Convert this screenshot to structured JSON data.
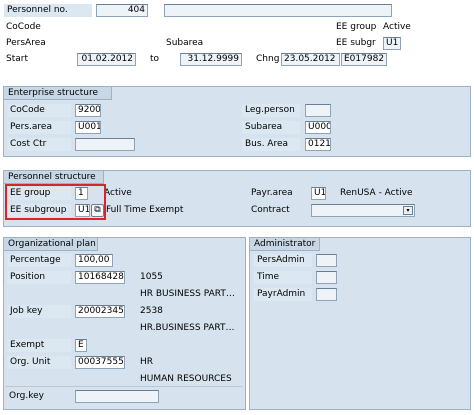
{
  "header": {
    "personnel_no_label": "Personnel no.",
    "personnel_no_value": "404",
    "personnel_name_value": "",
    "cocode_label": "CoCode",
    "ee_group_label": "EE group",
    "ee_group_value": "Active",
    "persarea_label": "PersArea",
    "subarea_label": "Subarea",
    "ee_subgr_label": "EE subgr",
    "ee_subgr_value": "U1",
    "start_label": "Start",
    "start_value": "01.02.2012",
    "to_label": "to",
    "end_value": "31.12.9999",
    "chng_label": "Chng",
    "chng_date_value": "23.05.2012",
    "chng_user_value": "E017982"
  },
  "enterprise": {
    "title": "Enterprise structure",
    "cocode_label": "CoCode",
    "cocode_value": "9200",
    "persarea_label": "Pers.area",
    "persarea_value": "U001",
    "costctr_label": "Cost Ctr",
    "costctr_value": "",
    "legperson_label": "Leg.person",
    "legperson_value": "",
    "subarea_label": "Subarea",
    "subarea_value": "U000",
    "busarea_label": "Bus. Area",
    "busarea_value": "0121"
  },
  "personnel": {
    "title": "Personnel structure",
    "eegroup_label": "EE group",
    "eegroup_value": "1",
    "eegroup_text": "Active",
    "eesubgroup_label": "EE subgroup",
    "eesubgroup_value": "U1",
    "eesubgroup_text": "Full Time Exempt",
    "payrarea_label": "Payr.area",
    "payrarea_value": "U1",
    "payrarea_text": "RenUSA - Active",
    "contract_label": "Contract",
    "contract_value": ""
  },
  "org": {
    "title": "Organizational plan",
    "percentage_label": "Percentage",
    "percentage_value": "100,00",
    "position_label": "Position",
    "position_value": "10168428",
    "position_num": "1055",
    "position_text": "HR BUSINESS PART…",
    "jobkey_label": "Job key",
    "jobkey_value": "20002345",
    "jobkey_num": "2538",
    "jobkey_text": "HR.BUSINESS PART…",
    "exempt_label": "Exempt",
    "exempt_value": "E",
    "orgunit_label": "Org. Unit",
    "orgunit_value": "00037555",
    "orgunit_abbr": "HR",
    "orgunit_text": "HUMAN RESOURCES",
    "orgkey_label": "Org.key",
    "orgkey_value": ""
  },
  "admin": {
    "title": "Administrator",
    "persadmin_label": "PersAdmin",
    "persadmin_value": "",
    "time_label": "Time",
    "time_value": "",
    "payradmin_label": "PayrAdmin",
    "payradmin_value": ""
  },
  "icons": {
    "dropdown": "▾",
    "possible_entries": "⧉"
  },
  "colors": {
    "highlight": "#d7262b",
    "panel_bg": "#d6e3ee"
  }
}
